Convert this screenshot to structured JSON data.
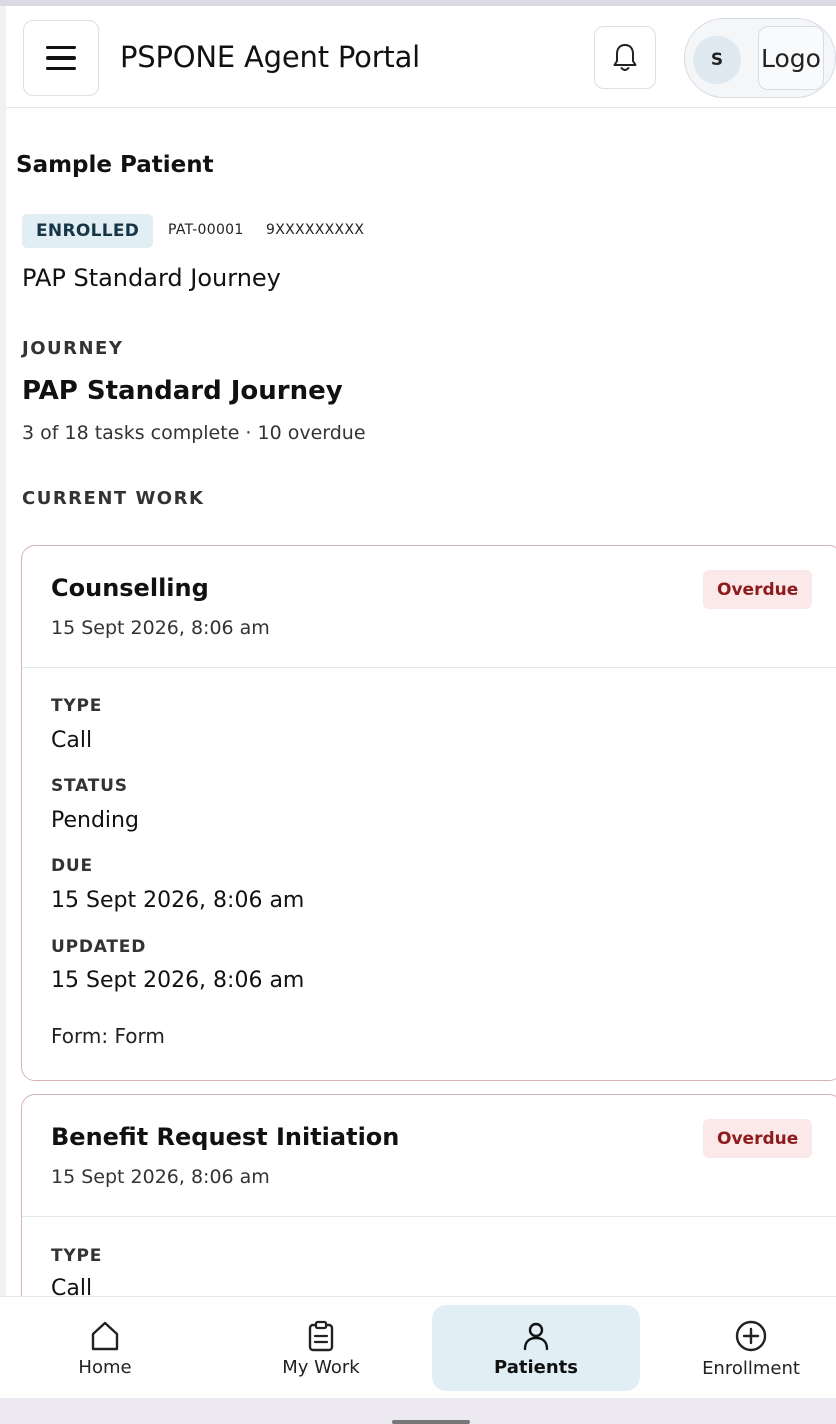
{
  "header": {
    "title": "PSPONE Agent Portal",
    "avatar_initial": "S",
    "logout_label": "Logout"
  },
  "patient": {
    "name": "Sample Patient",
    "status_badge": "ENROLLED",
    "patient_id": "PAT-00001",
    "phone": "9XXXXXXXXX",
    "program": "PAP Standard Journey"
  },
  "journey": {
    "section_label": "JOURNEY",
    "title": "PAP Standard Journey",
    "progress": "3 of 18 tasks complete · 10 overdue"
  },
  "current_work": {
    "section_label": "CURRENT WORK",
    "tasks": [
      {
        "title": "Counselling",
        "date": "15 Sept 2026, 8:06 am",
        "badge": "Overdue",
        "type_label": "TYPE",
        "type": "Call",
        "status_label": "STATUS",
        "status": "Pending",
        "due_label": "DUE",
        "due": "15 Sept 2026, 8:06 am",
        "updated_label": "UPDATED",
        "updated": "15 Sept 2026, 8:06 am",
        "form": "Form: Form"
      },
      {
        "title": "Benefit Request Initiation",
        "date": "15 Sept 2026, 8:06 am",
        "badge": "Overdue",
        "type_label": "TYPE",
        "type": "Call"
      }
    ]
  },
  "nav": {
    "items": [
      {
        "label": "Home",
        "icon": "home-icon",
        "active": false
      },
      {
        "label": "My Work",
        "icon": "clipboard-icon",
        "active": false
      },
      {
        "label": "Patients",
        "icon": "person-icon",
        "active": true
      },
      {
        "label": "Enrollment",
        "icon": "plus-circle-icon",
        "active": false
      }
    ]
  },
  "colors": {
    "accent_bg": "#e1eff4",
    "overdue_bg": "#fbe8e8",
    "overdue_text": "#8e1b1b",
    "card_border": "#d7b4b4"
  }
}
